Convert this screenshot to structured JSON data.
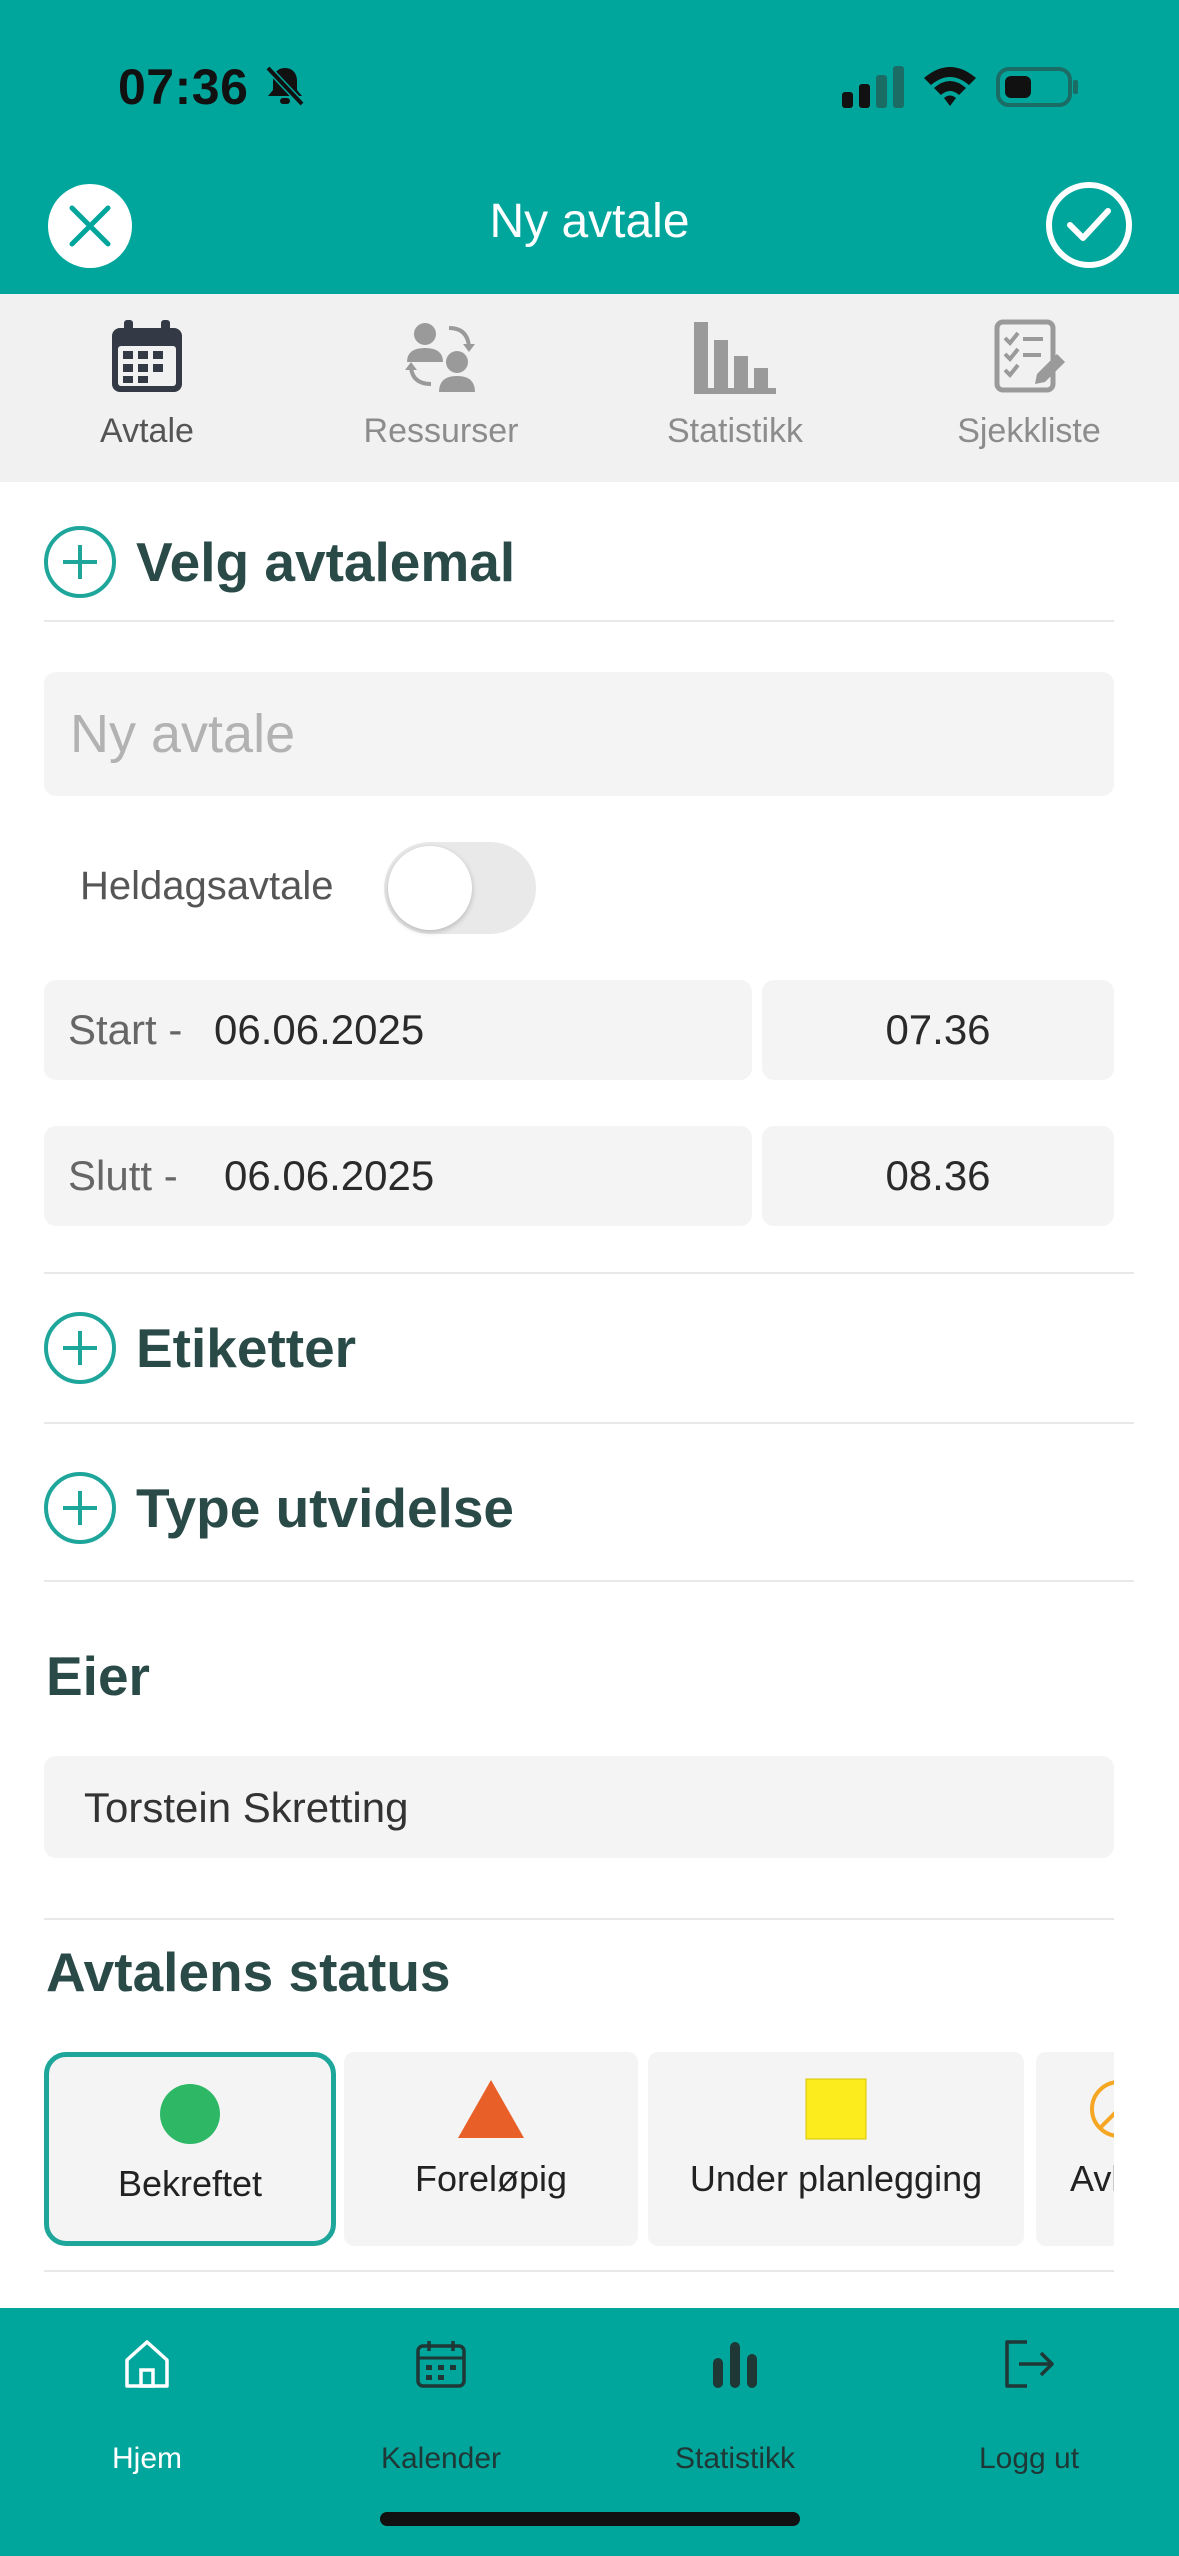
{
  "status_bar": {
    "time": "07:36"
  },
  "header": {
    "title": "Ny avtale"
  },
  "tabs": [
    {
      "label": "Avtale",
      "icon": "calendar-icon",
      "active": true
    },
    {
      "label": "Ressurser",
      "icon": "people-sync-icon"
    },
    {
      "label": "Statistikk",
      "icon": "bar-chart-icon"
    },
    {
      "label": "Sjekkliste",
      "icon": "checklist-icon"
    }
  ],
  "template": {
    "label": "Velg avtalemal"
  },
  "title_field": {
    "placeholder": "Ny avtale",
    "value": ""
  },
  "all_day": {
    "label": "Heldagsavtale",
    "enabled": false
  },
  "start": {
    "label": "Start -",
    "date": "06.06.2025",
    "time": "07.36"
  },
  "end": {
    "label": "Slutt -",
    "date": "06.06.2025",
    "time": "08.36"
  },
  "sections": {
    "labels": "Etiketter",
    "type_extension": "Type utvidelse"
  },
  "owner": {
    "title": "Eier",
    "name": "Torstein Skretting"
  },
  "status": {
    "title": "Avtalens status",
    "options": [
      {
        "label": "Bekreftet",
        "shape": "circle",
        "color": "#2eb866",
        "selected": true
      },
      {
        "label": "Foreløpig",
        "shape": "triangle",
        "color": "#e85f27"
      },
      {
        "label": "Under planlegging",
        "shape": "square",
        "color": "#fcec1e"
      },
      {
        "label": "Avlyst",
        "shape": "circle-slash",
        "color": "#f5a623"
      }
    ]
  },
  "bottom_nav": [
    {
      "label": "Hjem",
      "icon": "home-icon",
      "active": true
    },
    {
      "label": "Kalender",
      "icon": "calendar-icon"
    },
    {
      "label": "Statistikk",
      "icon": "bar-chart-icon"
    },
    {
      "label": "Logg ut",
      "icon": "logout-icon"
    }
  ],
  "colors": {
    "primary": "#00a69c",
    "accent": "#1ea69b",
    "heading": "#2a4a48",
    "field_bg": "#f4f4f4"
  }
}
